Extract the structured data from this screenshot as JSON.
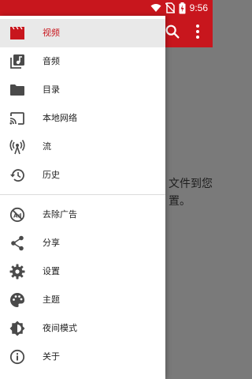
{
  "status_bar": {
    "time": "9:56"
  },
  "background": {
    "text_line1": "文件到您",
    "text_line2": "置。"
  },
  "drawer": {
    "items_top": [
      {
        "label": "视频",
        "icon": "video-clapper-icon",
        "selected": true
      },
      {
        "label": "音频",
        "icon": "audio-library-icon",
        "selected": false
      },
      {
        "label": "目录",
        "icon": "folder-icon",
        "selected": false
      },
      {
        "label": "本地网络",
        "icon": "cast-icon",
        "selected": false
      },
      {
        "label": "流",
        "icon": "antenna-icon",
        "selected": false
      },
      {
        "label": "历史",
        "icon": "history-icon",
        "selected": false
      }
    ],
    "items_bottom": [
      {
        "label": "去除广告",
        "icon": "no-ads-icon"
      },
      {
        "label": "分享",
        "icon": "share-icon"
      },
      {
        "label": "设置",
        "icon": "settings-gear-icon"
      },
      {
        "label": "主题",
        "icon": "palette-icon"
      },
      {
        "label": "夜间模式",
        "icon": "night-mode-icon"
      },
      {
        "label": "关于",
        "icon": "info-icon"
      }
    ]
  },
  "colors": {
    "accent": "#c8161d",
    "selected_bg": "#e9e9e9",
    "icon": "#4a4a4a"
  }
}
